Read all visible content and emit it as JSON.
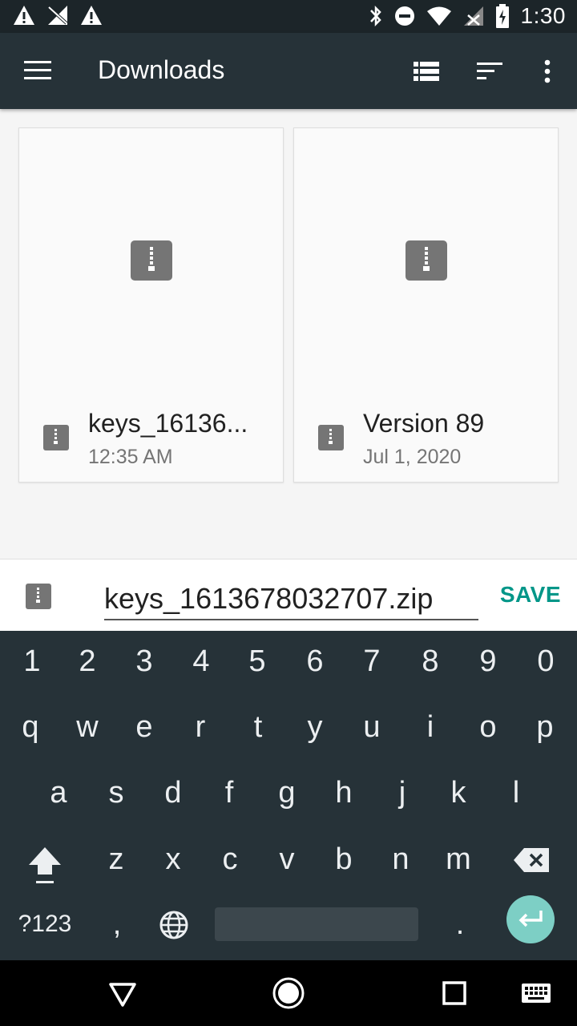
{
  "status_bar": {
    "time": "1:30",
    "icons_left": [
      "warning-icon",
      "no-signal-icon",
      "warning-icon"
    ],
    "icons_right": [
      "bluetooth-icon",
      "dnd-icon",
      "wifi-icon",
      "no-sim-icon",
      "battery-charging-icon"
    ]
  },
  "toolbar": {
    "title": "Downloads",
    "icons": [
      "menu-icon",
      "list-view-icon",
      "sort-icon",
      "more-vert-icon"
    ]
  },
  "files": [
    {
      "name": "keys_16136...",
      "date": "12:35 AM"
    },
    {
      "name": "Version 89",
      "date": "Jul 1, 2020"
    }
  ],
  "save_bar": {
    "filename": "keys_1613678032707.zip",
    "save_label": "SAVE"
  },
  "keyboard": {
    "row1": [
      "1",
      "2",
      "3",
      "4",
      "5",
      "6",
      "7",
      "8",
      "9",
      "0"
    ],
    "row2": [
      "q",
      "w",
      "e",
      "r",
      "t",
      "y",
      "u",
      "i",
      "o",
      "p"
    ],
    "row3": [
      "a",
      "s",
      "d",
      "f",
      "g",
      "h",
      "j",
      "k",
      "l"
    ],
    "row4": [
      "z",
      "x",
      "c",
      "v",
      "b",
      "n",
      "m"
    ],
    "symbols_label": "?123",
    "comma": ",",
    "period": "."
  },
  "colors": {
    "toolbar": "#263238",
    "status_bar": "#1c2529",
    "accent": "#009688",
    "enter": "#7dcfc5"
  }
}
